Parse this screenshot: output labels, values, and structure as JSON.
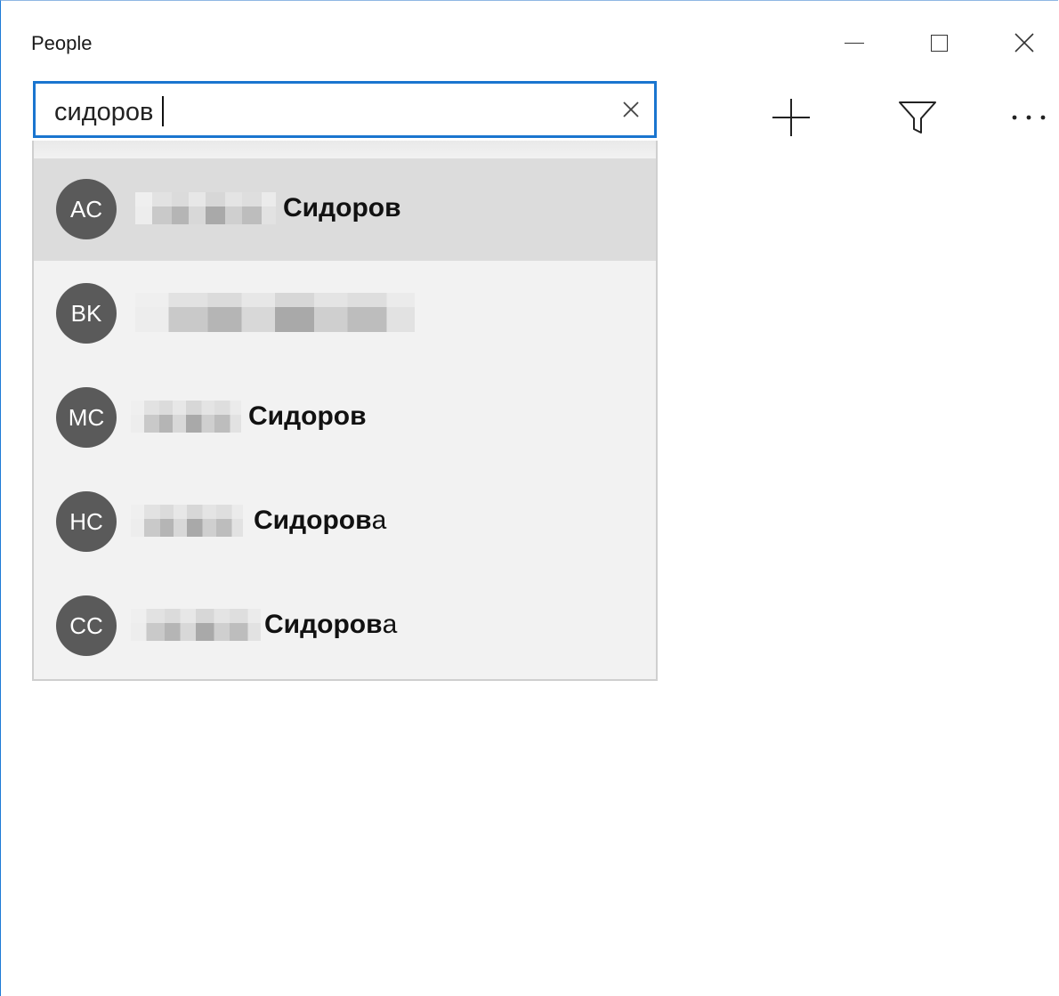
{
  "window": {
    "title": "People"
  },
  "search": {
    "value": "сидоров",
    "clear_icon": "close-icon"
  },
  "toolbar": {
    "add_icon": "plus-icon",
    "filter_icon": "filter-icon",
    "more_icon": "more-icon"
  },
  "suggestions": [
    {
      "initials": "AC",
      "surname_bold": "Сидоров",
      "surname_tail": "",
      "selected": true
    },
    {
      "initials": "BK",
      "surname_bold": "",
      "surname_tail": "",
      "selected": false
    },
    {
      "initials": "MC",
      "surname_bold": "Сидоров",
      "surname_tail": "",
      "selected": false
    },
    {
      "initials": "HC",
      "surname_bold": "Сидоров",
      "surname_tail": "а",
      "selected": false
    },
    {
      "initials": "CC",
      "surname_bold": "Сидоров",
      "surname_tail": "а",
      "selected": false
    }
  ],
  "colors": {
    "accent": "#1a75cf",
    "avatar": "#5a5a5a",
    "selected_row": "#dcdcdc",
    "dropdown_bg": "#f2f2f2"
  }
}
